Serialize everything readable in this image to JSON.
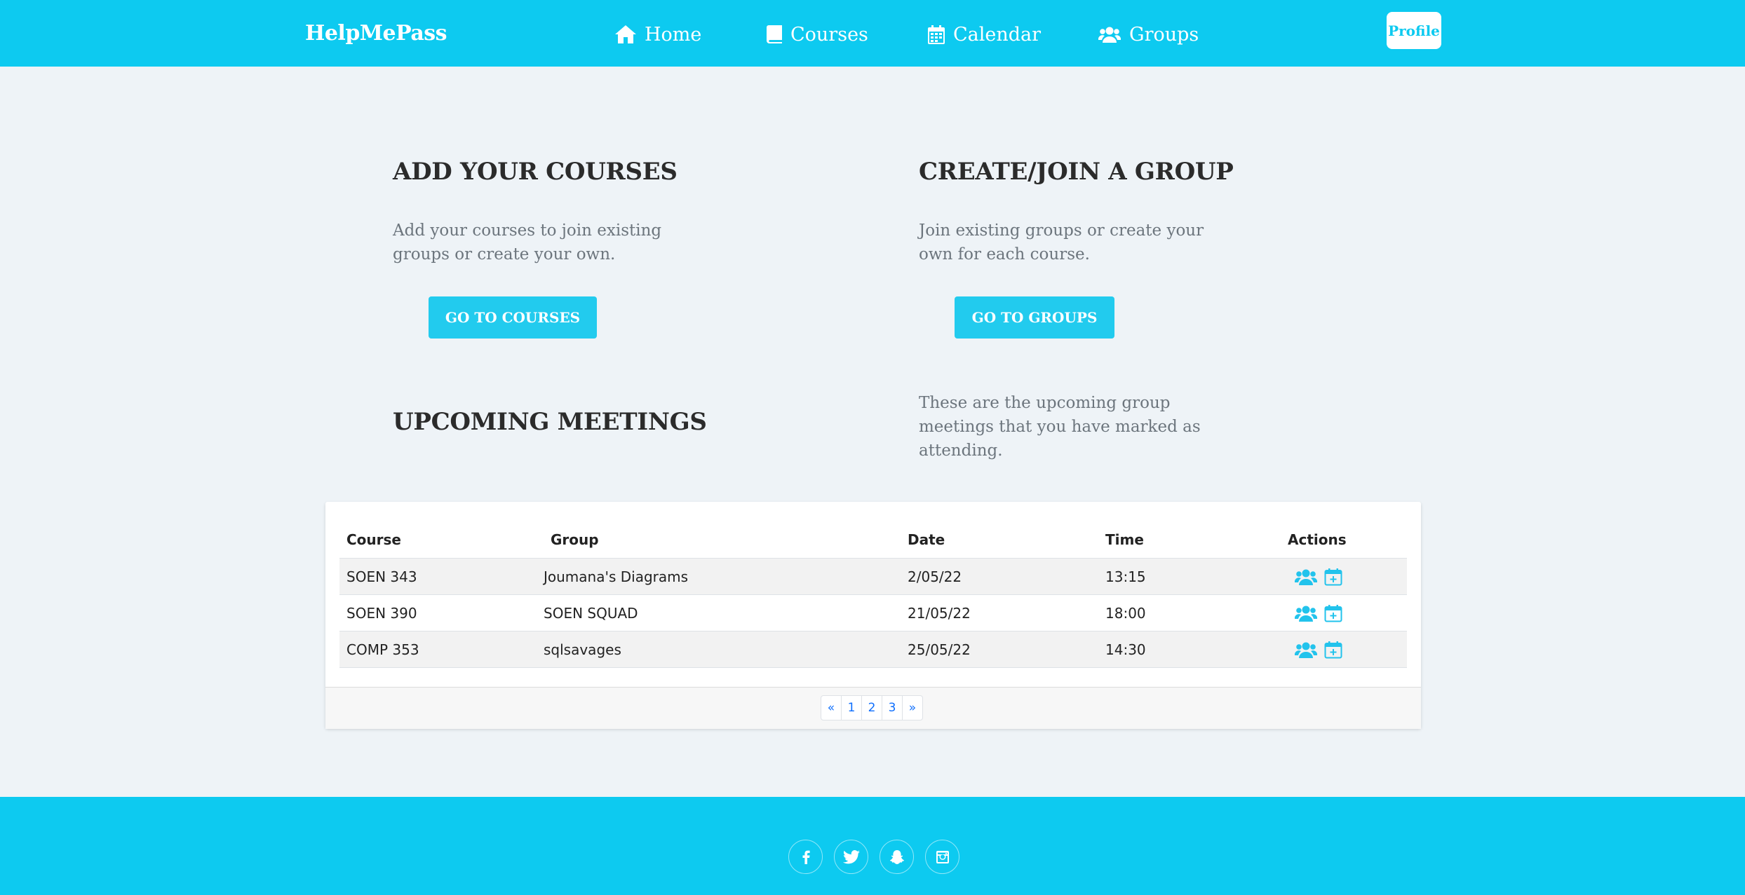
{
  "brand": "HelpMePass",
  "nav": {
    "home": {
      "label": "Home",
      "icon": "home-icon"
    },
    "courses": {
      "label": "Courses",
      "icon": "book-icon"
    },
    "calendar": {
      "label": "Calendar",
      "icon": "calendar-icon"
    },
    "groups": {
      "label": "Groups",
      "icon": "users-icon"
    }
  },
  "profile_label": "Profile",
  "sections": {
    "courses": {
      "title": "ADD YOUR COURSES",
      "text_line1": "Add your courses to join existing",
      "text_line2": "groups or create your own.",
      "button": "GO TO COURSES"
    },
    "groups": {
      "title": "CREATE/JOIN A GROUP",
      "text_line1": "Join existing groups or create your",
      "text_line2": "own for each course.",
      "button": "GO TO GROUPS"
    },
    "meetings": {
      "title": "UPCOMING MEETINGS",
      "text_line1": "These are the upcoming group",
      "text_line2": "meetings that you have marked as",
      "text_line3": "attending."
    }
  },
  "table": {
    "columns": [
      "Course",
      "Group",
      "Date",
      "Time",
      "Actions"
    ],
    "rows": [
      {
        "course": "SOEN 343",
        "group": "Joumana's Diagrams",
        "date": "2/05/22",
        "time": "13:15"
      },
      {
        "course": "SOEN 390",
        "group": "SOEN SQUAD",
        "date": "21/05/22",
        "time": "18:00"
      },
      {
        "course": "COMP 353",
        "group": "sqlsavages",
        "date": "25/05/22",
        "time": "14:30"
      }
    ],
    "row_actions": [
      "users-icon",
      "calendar-plus-icon"
    ]
  },
  "pagination": [
    "«",
    "1",
    "2",
    "3",
    "»"
  ],
  "footer_social": [
    "facebook-icon",
    "twitter-icon",
    "snapchat-icon",
    "instagram-icon"
  ],
  "colors": {
    "primary": "#0dcaf0",
    "button": "#22cbee",
    "page_bg": "#eef3f7",
    "link": "#0d6efd"
  }
}
